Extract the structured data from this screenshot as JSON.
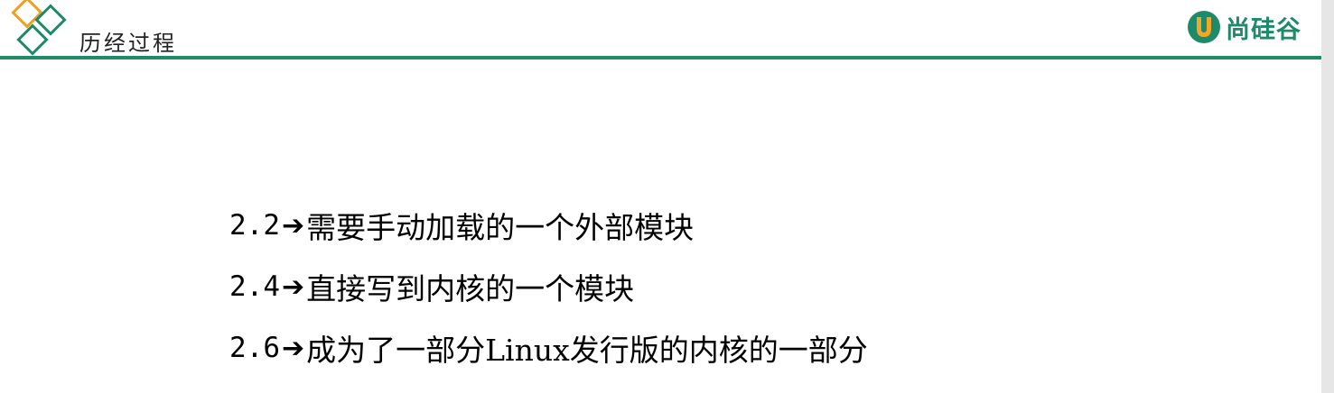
{
  "header": {
    "title": "历经过程",
    "brand": "尚硅谷",
    "logo_icon": "diamond-icon",
    "brand_icon": "u-shield-icon"
  },
  "colors": {
    "accent_green": "#1f8a6a",
    "diamond_orange": "#f0a020",
    "brand_orange": "#f5a623"
  },
  "arrow_glyph": "➔",
  "items": [
    {
      "version": "2.2",
      "text": "需要手动加载的一个外部模块"
    },
    {
      "version": "2.4",
      "text": "直接写到内核的一个模块"
    },
    {
      "version": "2.6",
      "text": "成为了一部分Linux发行版的内核的一部分"
    }
  ]
}
